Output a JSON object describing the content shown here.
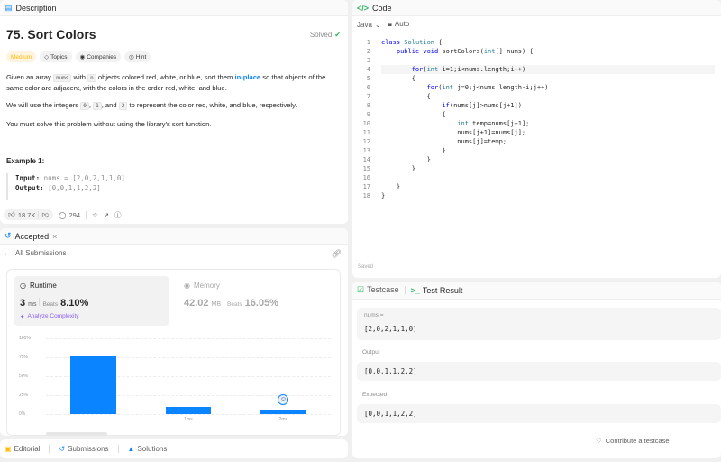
{
  "description": {
    "tab_label": "Description",
    "title": "75. Sort Colors",
    "solved_label": "Solved",
    "difficulty": "Medium",
    "tags": [
      "Topics",
      "Companies",
      "Hint"
    ],
    "para1": {
      "pre": "Given an array",
      "code1": "nums",
      "with": "with",
      "code2": "n",
      "mid": "objects colored red, white, or blue, sort them",
      "link": "in-place",
      "post": "so that objects of the",
      "line2": "same color are adjacent, with the colors in the order red, white, and blue."
    },
    "para2": {
      "pre": "We will use the integers",
      "c0": "0",
      "comma1": ",",
      "c1": "1",
      "and": ", and",
      "c2": "2",
      "post": "to represent the color red, white, and blue, respectively."
    },
    "para3": "You must solve this problem without using the library's sort function.",
    "example_heading": "Example 1:",
    "example_input_label": "Input:",
    "example_input_value": "nums = [2,0,2,1,1,0]",
    "example_output_label": "Output:",
    "example_output_value": "[0,0,1,1,2,2]",
    "likes": "18.7K",
    "comments": "294"
  },
  "accepted": {
    "tab_label": "Accepted",
    "back_label": "All Submissions",
    "runtime_label": "Runtime",
    "runtime_value": "3",
    "runtime_unit": "ms",
    "beats_label": "Beats",
    "runtime_beats": "8.10%",
    "analyze_label": "Analyze Complexity",
    "memory_label": "Memory",
    "memory_value": "42.02",
    "memory_unit": "MB",
    "memory_beats": "16.05%"
  },
  "chart_data": {
    "type": "bar",
    "categories": [
      "",
      "1ms",
      "2ms"
    ],
    "values": [
      0.76,
      0.09,
      0.06
    ],
    "yticks": [
      "100%",
      "75%",
      "50%",
      "25%",
      "0%"
    ],
    "ylim": [
      0,
      1
    ],
    "highlight_index": 2,
    "bar_color": "#0a84ff"
  },
  "bottom_tabs": [
    "Editorial",
    "Submissions",
    "Solutions"
  ],
  "code": {
    "tab_label": "Code",
    "language": "Java",
    "auto_label": "Auto",
    "saved_label": "Saved",
    "lines": [
      "class Solution {",
      "    public void sortColors(int[] nums) {",
      "",
      "        for(int i=1;i<nums.length;i++)",
      "        {",
      "            for(int j=0;j<nums.length-i;j++)",
      "            {",
      "                if(nums[j]>nums[j+1])",
      "                {",
      "                    int temp=nums[j+1];",
      "                    nums[j+1]=nums[j];",
      "                    nums[j]=temp;",
      "                }",
      "            }",
      "        }",
      "",
      "    }",
      "}"
    ]
  },
  "testcase": {
    "tab_testcase": "Testcase",
    "tab_result": "Test Result",
    "nums_label": "nums =",
    "input_value": "[2,0,2,1,1,0]",
    "output_label": "Output",
    "output_value": "[0,0,1,1,2,2]",
    "expected_label": "Expected",
    "expected_value": "[0,0,1,1,2,2]",
    "contribute_label": "Contribute a testcase"
  }
}
